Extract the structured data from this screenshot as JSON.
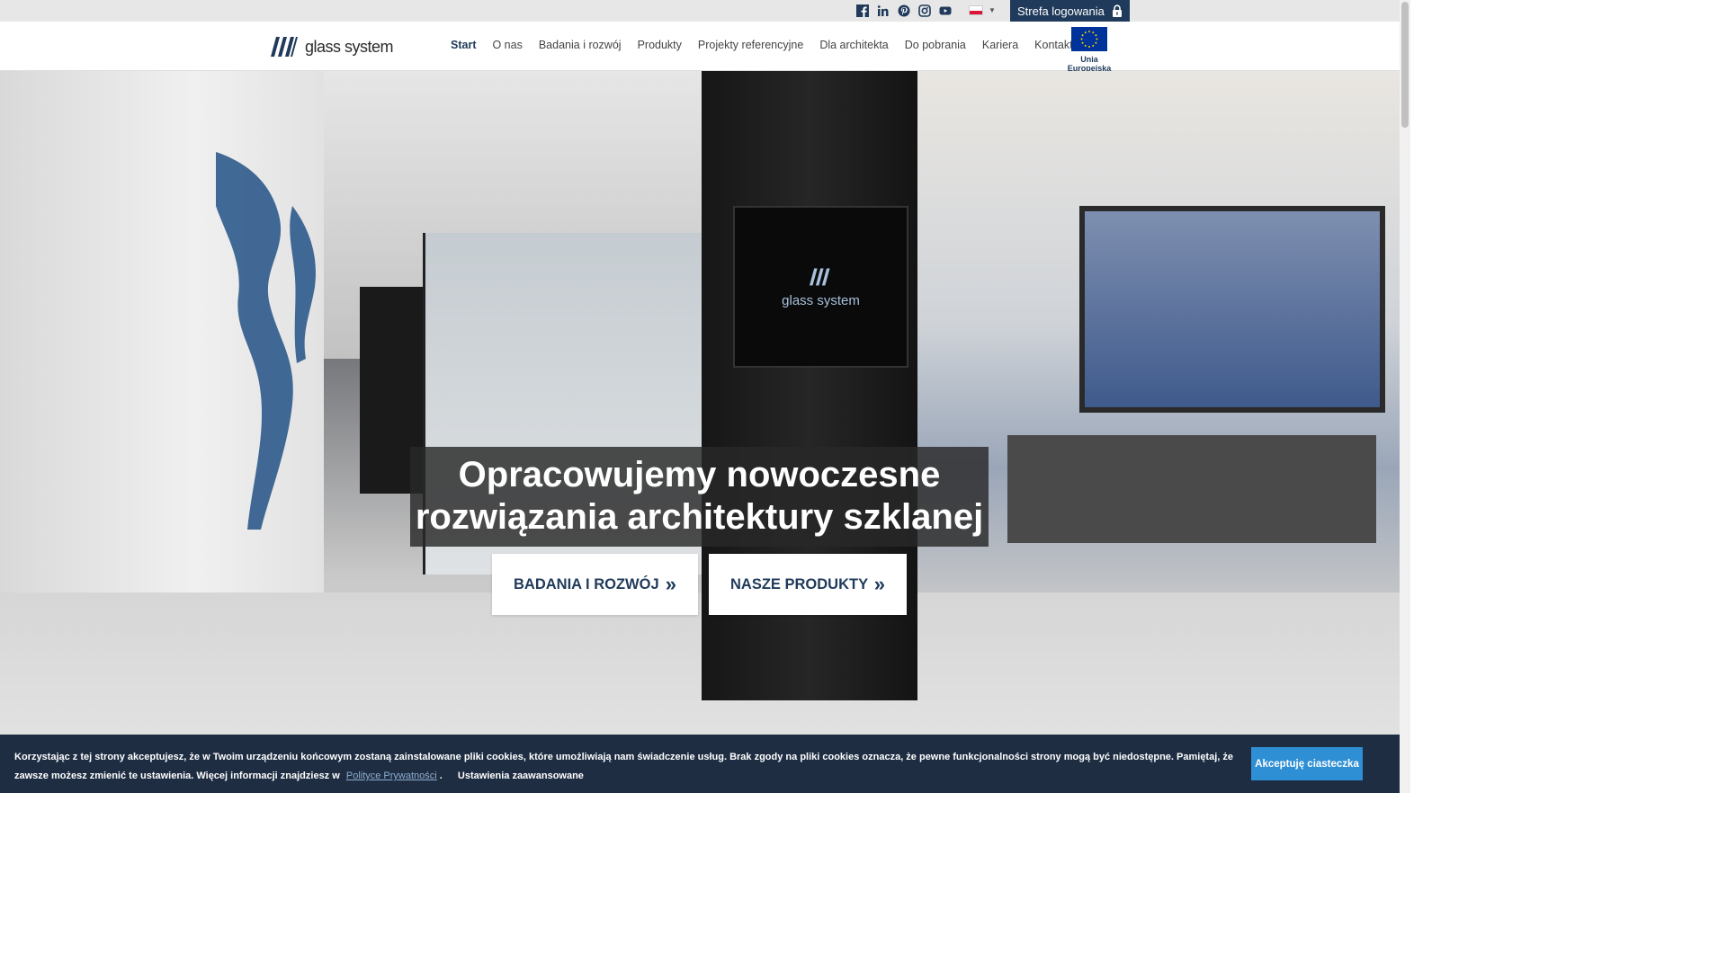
{
  "topbar": {
    "social_icons": [
      "facebook-icon",
      "linkedin-icon",
      "pinterest-icon",
      "instagram-icon",
      "youtube-icon"
    ],
    "language": "pl",
    "login_label": "Strefa logowania"
  },
  "nav": {
    "logo_text": "glass system",
    "items": [
      "Start",
      "O nas",
      "Badania i rozwój",
      "Produkty",
      "Projekty referencyjne",
      "Dla architekta",
      "Do pobrania",
      "Kariera",
      "Kontakt"
    ],
    "active": "Start",
    "eu_label": "Unia Europejska"
  },
  "hero": {
    "headline_line1": "Opracowujemy nowoczesne",
    "headline_line2": "rozwiązania architektury szklanej",
    "tv_logo_text": "glass system",
    "cta1": "BADANIA I ROZWÓJ",
    "cta2": "NASZE PRODUKTY",
    "cta_arrow": "»"
  },
  "cookie": {
    "text": "Korzystając z tej strony akceptujesz, że w Twoim urządzeniu końcowym zostaną zainstalowane pliki cookies, które umożliwiają nam świadczenie usług. Brak zgody na pliki cookies oznacza, że pewne funkcjonalności strony mogą być niedostępne. Pamiętaj, że zawsze możesz zmienić te ustawienia. Więcej informacji znajdziesz w",
    "policy_link": "Polityce Prywatności",
    "period": ".",
    "advanced_link": "Ustawienia zaawansowane",
    "accept_label": "Akceptuję ciasteczka"
  },
  "colors": {
    "brand": "#1f3a5a",
    "cookie_bg": "#1e2d42",
    "accept_bg": "#2f8fd4"
  }
}
